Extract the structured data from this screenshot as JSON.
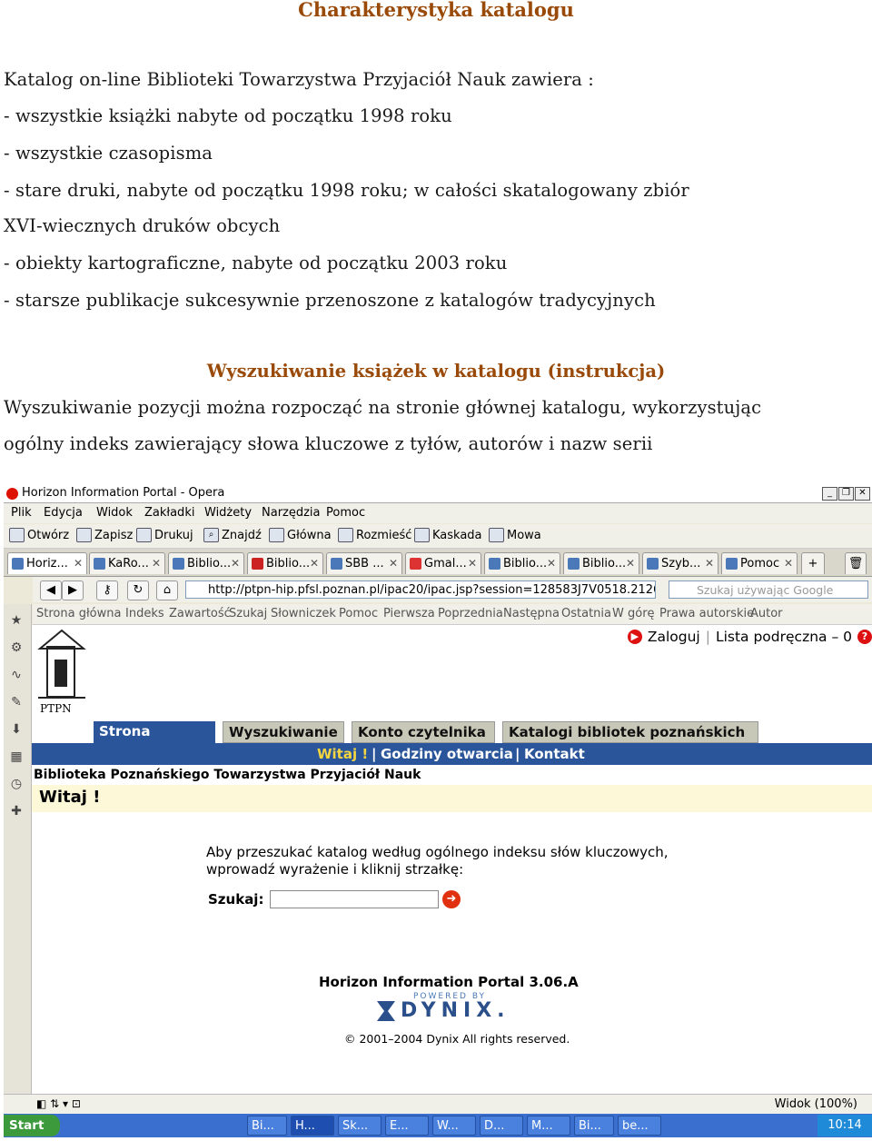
{
  "doc": {
    "title": "Charakterystyka katalogu",
    "intro": "Katalog on-line Biblioteki Towarzystwa Przyjaciół Nauk zawiera :",
    "items": [
      "- wszystkie książki nabyte od początku 1998 roku",
      "- wszystkie czasopisma",
      "- stare druki, nabyte od początku 1998 roku; w całości skatalogowany zbiór",
      "XVI-wiecznych druków obcych",
      "- obiekty kartograficzne, nabyte od początku 2003 roku",
      "- starsze publikacje sukcesywnie przenoszone z katalogów tradycyjnych"
    ],
    "section_title": "Wyszukiwanie książek w katalogu (instrukcja)",
    "para_line1": "Wyszukiwanie pozycji można rozpocząć na stronie głównej katalogu, wykorzystując",
    "para_line2": "ogólny indeks zawierający słowa kluczowe z tyłów, autorów i nazw serii"
  },
  "browser": {
    "window_title": "Horizon Information Portal - Opera",
    "menu": [
      "Plik",
      "Edycja",
      "Widok",
      "Zakładki",
      "Widżety",
      "Narzędzia",
      "Pomoc"
    ],
    "toolbar": [
      "Otwórz",
      "Zapisz",
      "Drukuj",
      "Znajdź",
      "Główna",
      "Rozmieść",
      "Kaskada",
      "Mowa"
    ],
    "tabs": [
      "Horiz...",
      "KaRo...",
      "Biblio...",
      "Biblio...",
      "SBB ...",
      "Gmal...",
      "Biblio...",
      "Biblio...",
      "Szyb...",
      "Pomoc"
    ],
    "address": "http://ptpn-hip.pfsl.poznan.pl/ipac20/ipac.jsp?session=128583J7V0518.2126&profile",
    "search_placeholder": "Szukaj używając Google",
    "nav_links": [
      "Strona główna",
      "Indeks",
      "Zawartość",
      "Szukaj",
      "Słowniczek",
      "Pomoc",
      "Pierwsza",
      "Poprzednia",
      "Następna",
      "Ostatnia",
      "W górę",
      "Prawa autorskie",
      "Autor"
    ],
    "zoom": "Widok (100%)"
  },
  "portal": {
    "logo_text": "PTPN",
    "login": "Zaloguj",
    "list": "Lista podręczna – 0",
    "tabs": [
      "Strona główna",
      "Wyszukiwanie",
      "Konto czytelnika",
      "Katalogi bibliotek poznańskich"
    ],
    "subnav": [
      "Witaj !",
      "Godziny otwarcia",
      "Kontakt"
    ],
    "library_name": "Biblioteka Poznańskiego Towarzystwa Przyjaciół Nauk",
    "welcome": "Witaj !",
    "instr_line1": "Aby przeszukać katalog według ogólnego indeksu słów kluczowych,",
    "instr_line2": "wprowadź wyrażenie i kliknij strzałkę:",
    "search_label": "Szukaj:",
    "footer_title": "Horizon Information Portal 3.06.A",
    "powered_by": "POWERED BY",
    "dynix": "DYNIX.",
    "copyright": "© 2001–2004 Dynix All rights reserved."
  },
  "taskbar": {
    "start": "Start",
    "buttons": [
      "Bi...",
      "H...",
      "Sk...",
      "E...",
      "W...",
      "D...",
      "M...",
      "Bi...",
      "be..."
    ],
    "clock": "10:14"
  }
}
